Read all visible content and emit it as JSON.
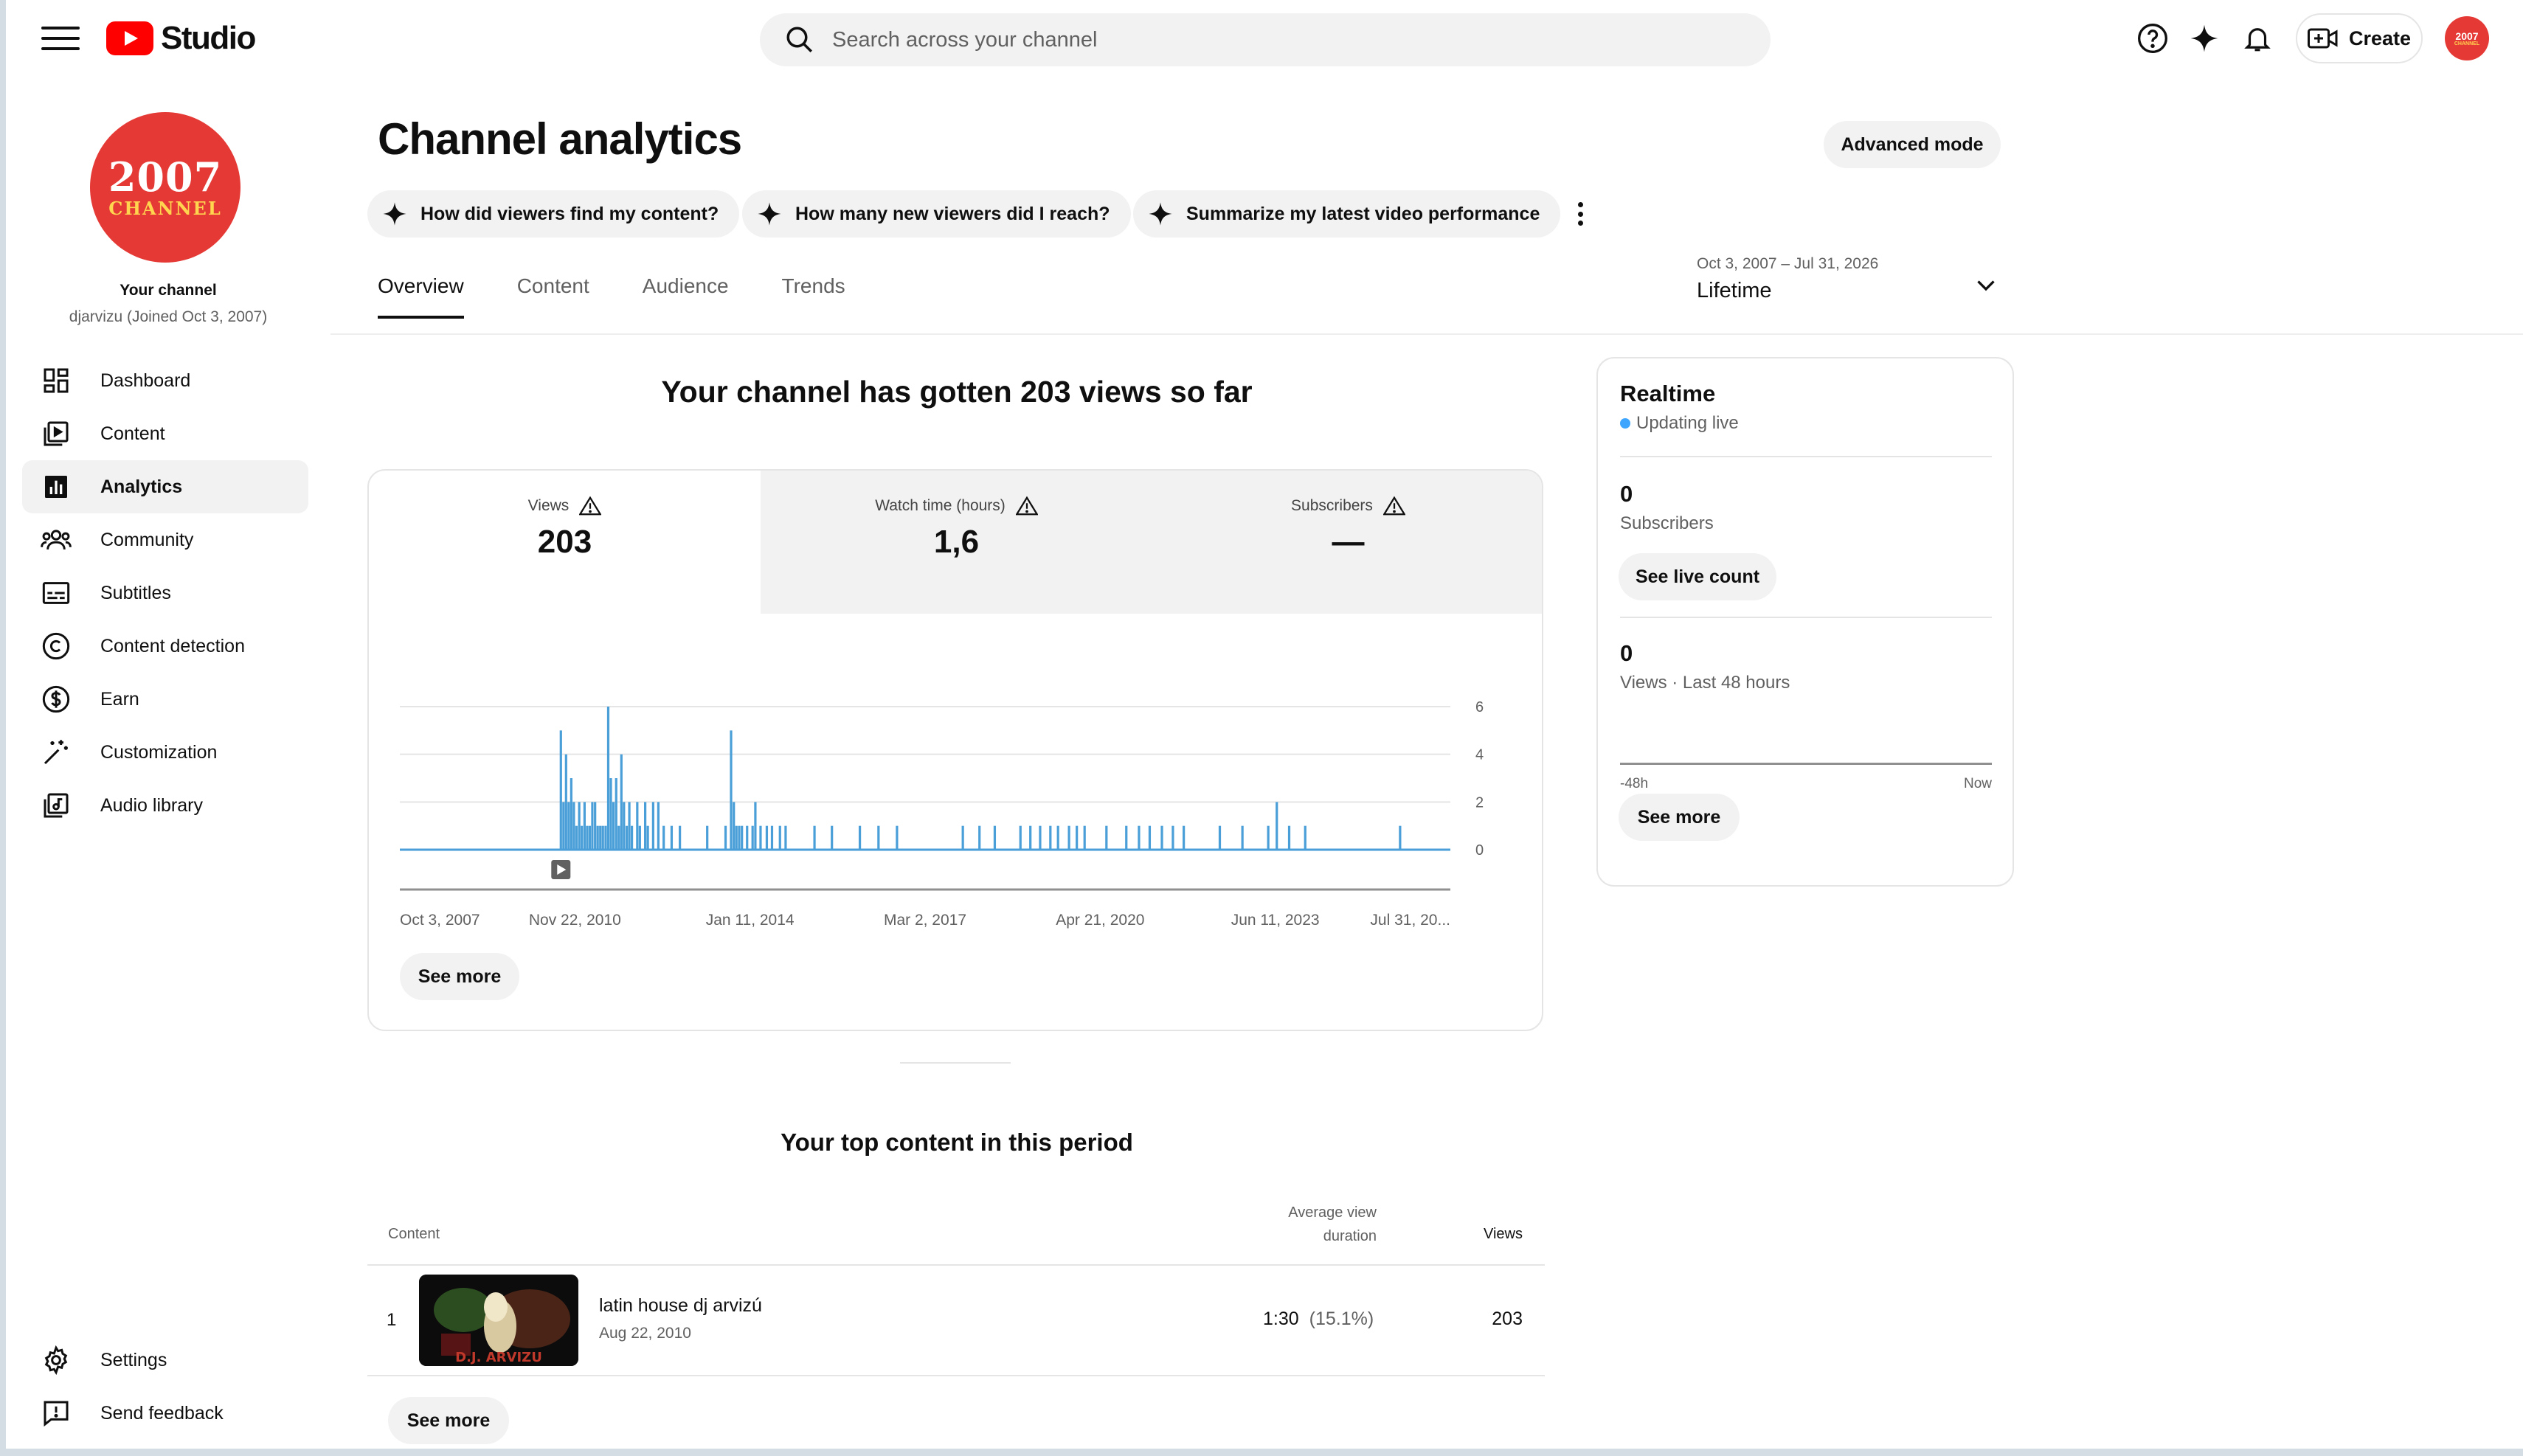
{
  "header": {
    "logo_text": "Studio",
    "search_placeholder": "Search across your channel",
    "create_label": "Create",
    "avatar_line1": "2007",
    "avatar_line2": "CHANNEL"
  },
  "sidebar": {
    "avatar_line1": "2007",
    "avatar_line2": "CHANNEL",
    "your_channel": "Your channel",
    "handle": "djarvizu (Joined Oct 3, 2007)",
    "items": [
      {
        "label": "Dashboard",
        "icon": "dashboard-icon"
      },
      {
        "label": "Content",
        "icon": "content-icon"
      },
      {
        "label": "Analytics",
        "icon": "analytics-icon",
        "active": true
      },
      {
        "label": "Community",
        "icon": "community-icon"
      },
      {
        "label": "Subtitles",
        "icon": "subtitles-icon"
      },
      {
        "label": "Content detection",
        "icon": "copyright-icon"
      },
      {
        "label": "Earn",
        "icon": "dollar-icon"
      },
      {
        "label": "Customization",
        "icon": "magic-wand-icon"
      },
      {
        "label": "Audio library",
        "icon": "audio-library-icon"
      }
    ],
    "bottom_items": [
      {
        "label": "Settings",
        "icon": "gear-icon"
      },
      {
        "label": "Send feedback",
        "icon": "feedback-icon"
      }
    ]
  },
  "main": {
    "title": "Channel analytics",
    "advanced_mode": "Advanced mode",
    "chips": [
      "How did viewers find my content?",
      "How many new viewers did I reach?",
      "Summarize my latest video performance"
    ],
    "tabs": [
      {
        "label": "Overview",
        "active": true
      },
      {
        "label": "Content"
      },
      {
        "label": "Audience"
      },
      {
        "label": "Trends"
      }
    ],
    "date_range": {
      "range": "Oct 3, 2007 – Jul 31, 2026",
      "label": "Lifetime"
    },
    "heading": "Your channel has gotten 203 views so far",
    "metrics": [
      {
        "label": "Views",
        "value": "203",
        "active": true
      },
      {
        "label": "Watch time (hours)",
        "value": "1,6"
      },
      {
        "label": "Subscribers",
        "value": "—"
      }
    ],
    "see_more": "See more"
  },
  "chart_data": {
    "type": "bar",
    "x_tick_labels": [
      "Oct 3, 2007",
      "Nov 22, 2010",
      "Jan 11, 2014",
      "Mar 2, 2017",
      "Apr 21, 2020",
      "Jun 11, 2023",
      "Jul 31, 20..."
    ],
    "y_ticks": [
      0,
      2,
      4,
      6
    ],
    "ylim": [
      0,
      6
    ],
    "x_range": [
      "2007-10-03",
      "2026-07-31"
    ],
    "upload_marker_date": "2010-08-22",
    "points": [
      {
        "date": "2010-08-22",
        "views": 5
      },
      {
        "date": "2010-09-08",
        "views": 2
      },
      {
        "date": "2010-09-25",
        "views": 4
      },
      {
        "date": "2010-10-12",
        "views": 2
      },
      {
        "date": "2010-10-29",
        "views": 3
      },
      {
        "date": "2010-11-15",
        "views": 2
      },
      {
        "date": "2010-12-02",
        "views": 1
      },
      {
        "date": "2010-12-20",
        "views": 2
      },
      {
        "date": "2011-01-06",
        "views": 1
      },
      {
        "date": "2011-01-24",
        "views": 2
      },
      {
        "date": "2011-02-10",
        "views": 1
      },
      {
        "date": "2011-02-27",
        "views": 1
      },
      {
        "date": "2011-03-16",
        "views": 2
      },
      {
        "date": "2011-04-03",
        "views": 2
      },
      {
        "date": "2011-04-20",
        "views": 1
      },
      {
        "date": "2011-05-07",
        "views": 1
      },
      {
        "date": "2011-05-24",
        "views": 1
      },
      {
        "date": "2011-06-11",
        "views": 1
      },
      {
        "date": "2011-06-28",
        "views": 6
      },
      {
        "date": "2011-07-15",
        "views": 3
      },
      {
        "date": "2011-08-01",
        "views": 2
      },
      {
        "date": "2011-08-19",
        "views": 3
      },
      {
        "date": "2011-09-05",
        "views": 1
      },
      {
        "date": "2011-09-22",
        "views": 4
      },
      {
        "date": "2011-10-09",
        "views": 2
      },
      {
        "date": "2011-10-27",
        "views": 1
      },
      {
        "date": "2011-11-13",
        "views": 2
      },
      {
        "date": "2011-11-30",
        "views": 1
      },
      {
        "date": "2012-01-04",
        "views": 2
      },
      {
        "date": "2012-01-21",
        "views": 1
      },
      {
        "date": "2012-02-25",
        "views": 2
      },
      {
        "date": "2012-03-13",
        "views": 1
      },
      {
        "date": "2012-04-17",
        "views": 2
      },
      {
        "date": "2012-05-21",
        "views": 2
      },
      {
        "date": "2012-06-25",
        "views": 1
      },
      {
        "date": "2012-08-16",
        "views": 1
      },
      {
        "date": "2012-10-09",
        "views": 1
      },
      {
        "date": "2013-04-06",
        "views": 1
      },
      {
        "date": "2013-08-04",
        "views": 1
      },
      {
        "date": "2013-09-09",
        "views": 5
      },
      {
        "date": "2013-09-27",
        "views": 2
      },
      {
        "date": "2013-10-14",
        "views": 1
      },
      {
        "date": "2013-11-01",
        "views": 1
      },
      {
        "date": "2013-11-19",
        "views": 1
      },
      {
        "date": "2013-12-23",
        "views": 1
      },
      {
        "date": "2014-01-28",
        "views": 1
      },
      {
        "date": "2014-02-15",
        "views": 2
      },
      {
        "date": "2014-03-21",
        "views": 1
      },
      {
        "date": "2014-05-01",
        "views": 1
      },
      {
        "date": "2014-06-04",
        "views": 1
      },
      {
        "date": "2014-07-26",
        "views": 1
      },
      {
        "date": "2014-09-01",
        "views": 1
      },
      {
        "date": "2015-03-09",
        "views": 1
      },
      {
        "date": "2015-07-01",
        "views": 1
      },
      {
        "date": "2015-12-31",
        "views": 1
      },
      {
        "date": "2016-05-01",
        "views": 1
      },
      {
        "date": "2016-08-30",
        "views": 1
      },
      {
        "date": "2017-11-04",
        "views": 1
      },
      {
        "date": "2018-02-21",
        "views": 1
      },
      {
        "date": "2018-06-01",
        "views": 1
      },
      {
        "date": "2018-11-16",
        "views": 1
      },
      {
        "date": "2019-01-20",
        "views": 1
      },
      {
        "date": "2019-03-25",
        "views": 1
      },
      {
        "date": "2019-05-31",
        "views": 1
      },
      {
        "date": "2019-07-20",
        "views": 1
      },
      {
        "date": "2019-09-30",
        "views": 1
      },
      {
        "date": "2019-11-20",
        "views": 1
      },
      {
        "date": "2020-01-10",
        "views": 1
      },
      {
        "date": "2020-06-01",
        "views": 1
      },
      {
        "date": "2020-10-09",
        "views": 1
      },
      {
        "date": "2020-12-31",
        "views": 1
      },
      {
        "date": "2021-03-11",
        "views": 1
      },
      {
        "date": "2021-05-30",
        "views": 1
      },
      {
        "date": "2021-08-10",
        "views": 1
      },
      {
        "date": "2021-10-20",
        "views": 1
      },
      {
        "date": "2022-06-13",
        "views": 1
      },
      {
        "date": "2022-11-08",
        "views": 1
      },
      {
        "date": "2023-04-26",
        "views": 1
      },
      {
        "date": "2023-06-21",
        "views": 2
      },
      {
        "date": "2023-09-10",
        "views": 1
      },
      {
        "date": "2023-12-24",
        "views": 1
      },
      {
        "date": "2025-09-05",
        "views": 1
      }
    ]
  },
  "top_content": {
    "heading": "Your top content in this period",
    "col_content": "Content",
    "col_avd_line1": "Average view",
    "col_avd_line2": "duration",
    "col_views": "Views",
    "rows": [
      {
        "rank": "1",
        "title": "latin house dj arvizú",
        "date": "Aug 22, 2010",
        "avd": "1:30",
        "avd_pct": "(15.1%)",
        "views": "203",
        "thumb_text": "D.J. ARVIZU"
      }
    ],
    "see_more": "See more"
  },
  "realtime": {
    "title": "Realtime",
    "status": "Updating live",
    "subscribers_value": "0",
    "subscribers_label": "Subscribers",
    "live_count_button": "See live count",
    "views_value": "0",
    "views_label": "Views · Last 48 hours",
    "axis_start": "-48h",
    "axis_end": "Now",
    "see_more": "See more"
  }
}
